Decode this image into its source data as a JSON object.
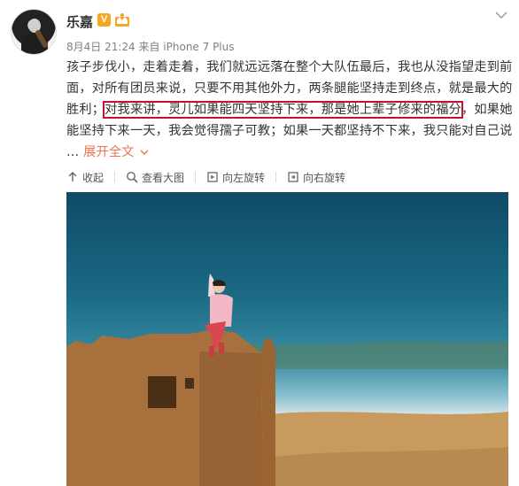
{
  "post": {
    "username": "乐嘉",
    "badge_v": "V",
    "meta": "8月4日 21:24 来自 iPhone 7 Plus",
    "lines": [
      "孩子步伐小，走着走着，我们就远远落在整个大队伍最后，我也从没指望走到前",
      "面，对所有团员来说，只要不用其他外力，两条腿能坚持走到终点，就是最大的",
      "胜利；",
      "对我来讲，灵儿如果能四天坚持下来，那是她上辈子修来的福分",
      "，如果她",
      "能坚持下来一天，我会觉得孺子可教；如果一天都坚持不下来，我只能对自己说",
      "…  ",
      "展开全文"
    ]
  },
  "toolbar": {
    "collapse": "收起",
    "view_large": "查看大图",
    "rotate_left": "向左旋转",
    "rotate_right": "向右旋转"
  },
  "icons": {
    "vip": "vip-crown-icon",
    "menu": "chevron-down-icon"
  },
  "colors": {
    "highlight": "#c8102e",
    "link": "#eb7350",
    "badge": "#f6a623"
  }
}
